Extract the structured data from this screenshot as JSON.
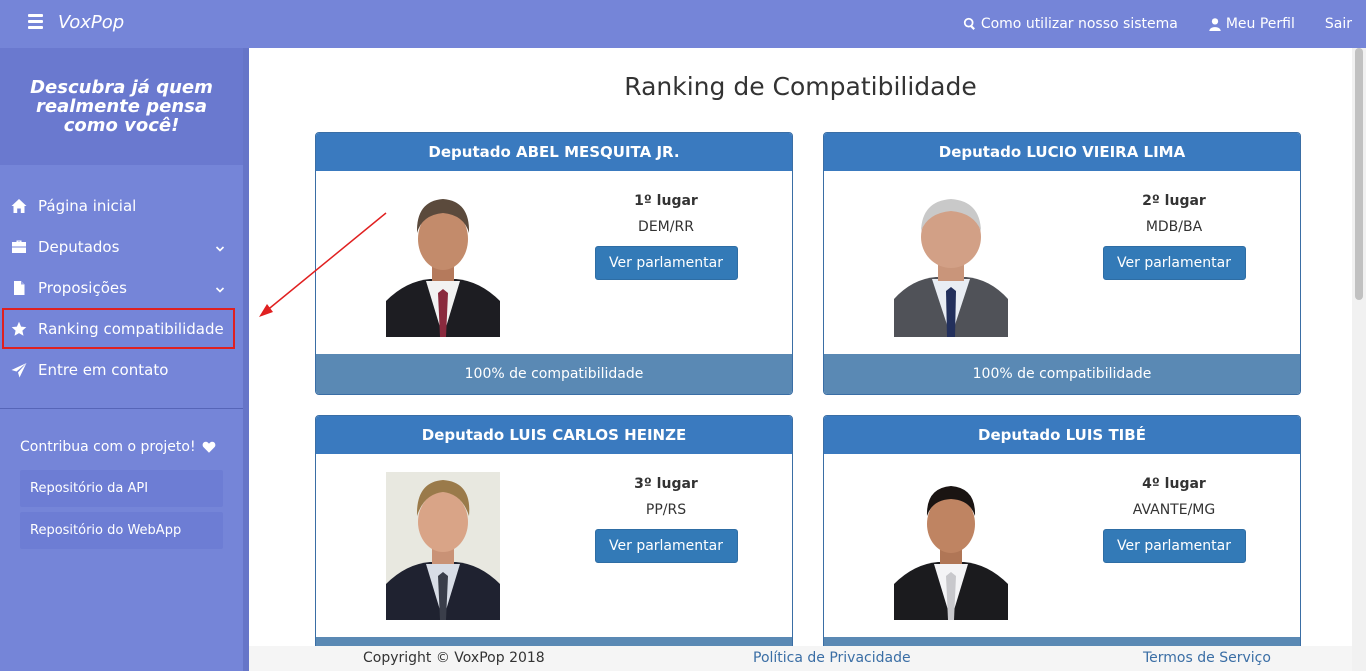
{
  "app": {
    "brand": "VoxPop"
  },
  "topnav": {
    "help": "Como utilizar nosso sistema",
    "profile": "Meu Perfil",
    "logout": "Sair"
  },
  "sidebar": {
    "tagline": "Descubra já quem realmente pensa como você!",
    "items": [
      {
        "label": "Página inicial",
        "icon": "home-icon"
      },
      {
        "label": "Deputados",
        "icon": "briefcase-icon"
      },
      {
        "label": "Proposições",
        "icon": "file-icon"
      },
      {
        "label": "Ranking compatibilidade",
        "icon": "star-icon"
      },
      {
        "label": "Entre em contato",
        "icon": "paper-plane-icon"
      }
    ],
    "contribute": {
      "title": "Contribua com o projeto!",
      "api_repo": "Repositório da API",
      "webapp_repo": "Repositório do WebApp"
    }
  },
  "main": {
    "title": "Ranking de Compatibilidade",
    "cards": [
      {
        "name": "Deputado ABEL MESQUITA JR.",
        "rank": "1º lugar",
        "party": "DEM/RR",
        "button": "Ver parlamentar",
        "compat": "100% de compatibilidade"
      },
      {
        "name": "Deputado LUCIO VIEIRA LIMA",
        "rank": "2º lugar",
        "party": "MDB/BA",
        "button": "Ver parlamentar",
        "compat": "100% de compatibilidade"
      },
      {
        "name": "Deputado LUIS CARLOS HEINZE",
        "rank": "3º lugar",
        "party": "PP/RS",
        "button": "Ver parlamentar",
        "compat": ""
      },
      {
        "name": "Deputado LUIS TIBÉ",
        "rank": "4º lugar",
        "party": "AVANTE/MG",
        "button": "Ver parlamentar",
        "compat": ""
      }
    ]
  },
  "footer": {
    "copyright": "Copyright © VoxPop 2018",
    "privacy": "Política de Privacidade",
    "terms": "Termos de Serviço"
  },
  "colors": {
    "nav_bg": "#7585d8",
    "card_header": "#3a7abf",
    "card_footer": "#5a89b4",
    "button": "#337ab7",
    "annotation": "#e02020"
  }
}
